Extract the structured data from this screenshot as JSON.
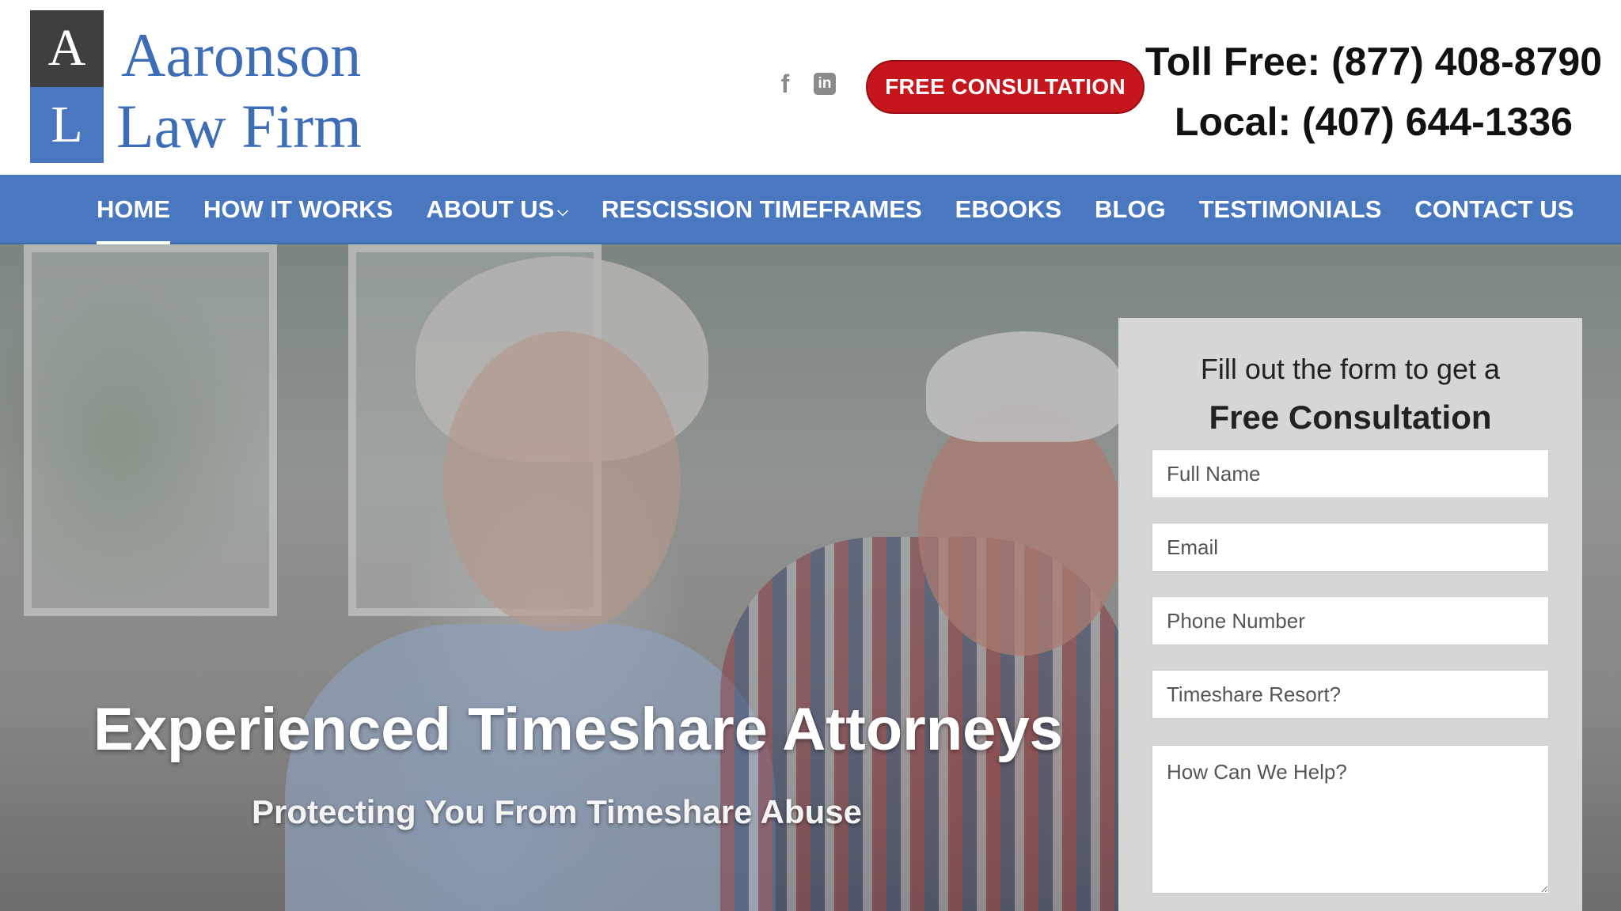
{
  "brand": {
    "initial_top": "A",
    "initial_bottom": "L",
    "name_line1": "Aaronson",
    "name_line2": "Law Firm",
    "primary_color": "#4a78c0",
    "cta_color": "#c5161d"
  },
  "social": {
    "facebook_icon": "f",
    "linkedin_icon": "in"
  },
  "header": {
    "cta_label": "FREE CONSULTATION",
    "toll_free": "Toll Free: (877) 408-8790",
    "local": "Local: (407) 644-1336"
  },
  "nav": {
    "items": [
      {
        "label": "HOME",
        "active": true
      },
      {
        "label": "HOW IT WORKS"
      },
      {
        "label": "ABOUT US",
        "has_dropdown": true
      },
      {
        "label": "RESCISSION TIMEFRAMES"
      },
      {
        "label": "EBOOKS"
      },
      {
        "label": "BLOG"
      },
      {
        "label": "TESTIMONIALS"
      },
      {
        "label": "CONTACT US"
      }
    ]
  },
  "hero": {
    "title": "Experienced Timeshare Attorneys",
    "subtitle": "Protecting You From Timeshare Abuse"
  },
  "form": {
    "lead": "Fill out the form to get a",
    "heading": "Free Consultation",
    "full_name_placeholder": "Full Name",
    "email_placeholder": "Email",
    "phone_placeholder": "Phone Number",
    "resort_placeholder": "Timeshare Resort?",
    "help_placeholder": "How Can We Help?"
  }
}
